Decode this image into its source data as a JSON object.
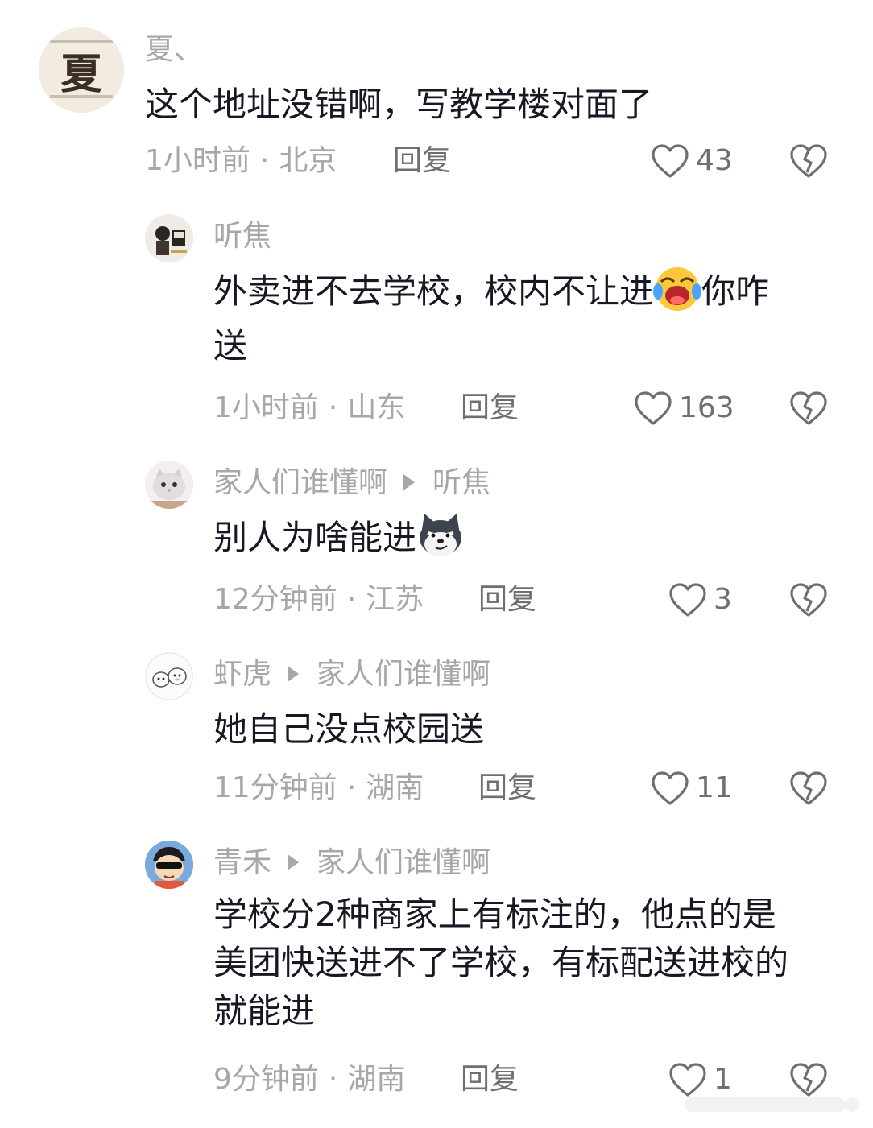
{
  "comments": [
    {
      "username": "夏、",
      "avatar_text": "夏",
      "text": "这个地址没错啊，写教学楼对面了",
      "time": "1小时前",
      "location": "北京",
      "reply_label": "回复",
      "likes": "43"
    },
    {
      "username": "听焦",
      "text_line1": "外卖进不去学校，校内不让进",
      "text_after_emoji": "你咋",
      "text_line2": "送",
      "emoji": "laughing-crying-emoji",
      "time": "1小时前",
      "location": "山东",
      "reply_label": "回复",
      "likes": "163"
    },
    {
      "username": "家人们谁懂啊",
      "reply_to": "听焦",
      "text": "别人为啥能进",
      "emoji": "smirking-dog-emoji",
      "time": "12分钟前",
      "location": "江苏",
      "reply_label": "回复",
      "likes": "3"
    },
    {
      "username": "虾虎",
      "reply_to": "家人们谁懂啊",
      "text": "她自己没点校园送",
      "time": "11分钟前",
      "location": "湖南",
      "reply_label": "回复",
      "likes": "11"
    },
    {
      "username": "青禾",
      "reply_to": "家人们谁懂啊",
      "text_line1": "学校分2种商家上有标注的，他点的是",
      "text_line2": "美团快送进不了学校，有标配送进校的",
      "text_line3": "就能进",
      "time": "9分钟前",
      "location": "湖南",
      "reply_label": "回复",
      "likes": "1"
    }
  ],
  "separator": "·",
  "icons": {
    "like": "heart-outline-icon",
    "dislike": "broken-heart-icon"
  },
  "colors": {
    "text": "#161823",
    "muted": "#a7a7a9",
    "action": "#6f6f72"
  }
}
